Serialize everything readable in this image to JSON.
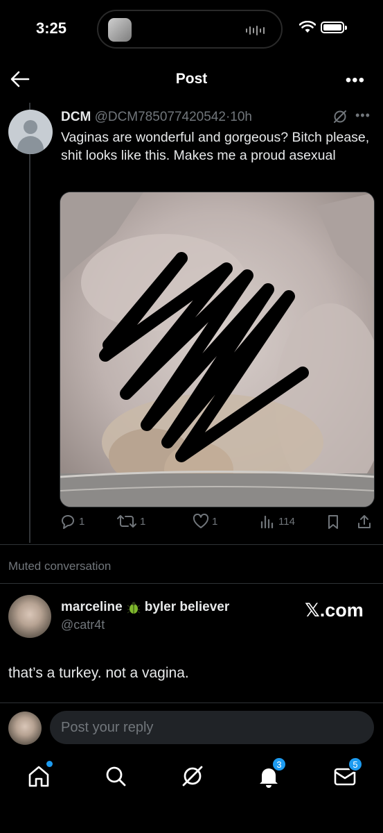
{
  "status_bar": {
    "time": "3:25"
  },
  "header": {
    "title": "Post"
  },
  "tweet": {
    "author_name": "DCM",
    "author_handle": "@DCM785077420542",
    "age": "10h",
    "separator": "·",
    "text": "Vaginas are wonderful and gorgeous? Bitch please, shit looks like this. Makes me a proud asexual",
    "stats": {
      "replies": "1",
      "reposts": "1",
      "likes": "1",
      "views": "114"
    }
  },
  "muted_label": "Muted conversation",
  "reply": {
    "author_name": "marceline",
    "author_name_suffix": "byler believer",
    "author_handle": "@catr4t",
    "text": "that’s a turkey. not a vagina."
  },
  "watermark": "𝕏.com",
  "composer": {
    "placeholder": "Post your reply"
  },
  "tabbar": {
    "notifications_badge": "3",
    "messages_badge": "5"
  },
  "colors": {
    "accent": "#1d9bf0",
    "muted": "#71767b",
    "divider": "#2f3336"
  }
}
